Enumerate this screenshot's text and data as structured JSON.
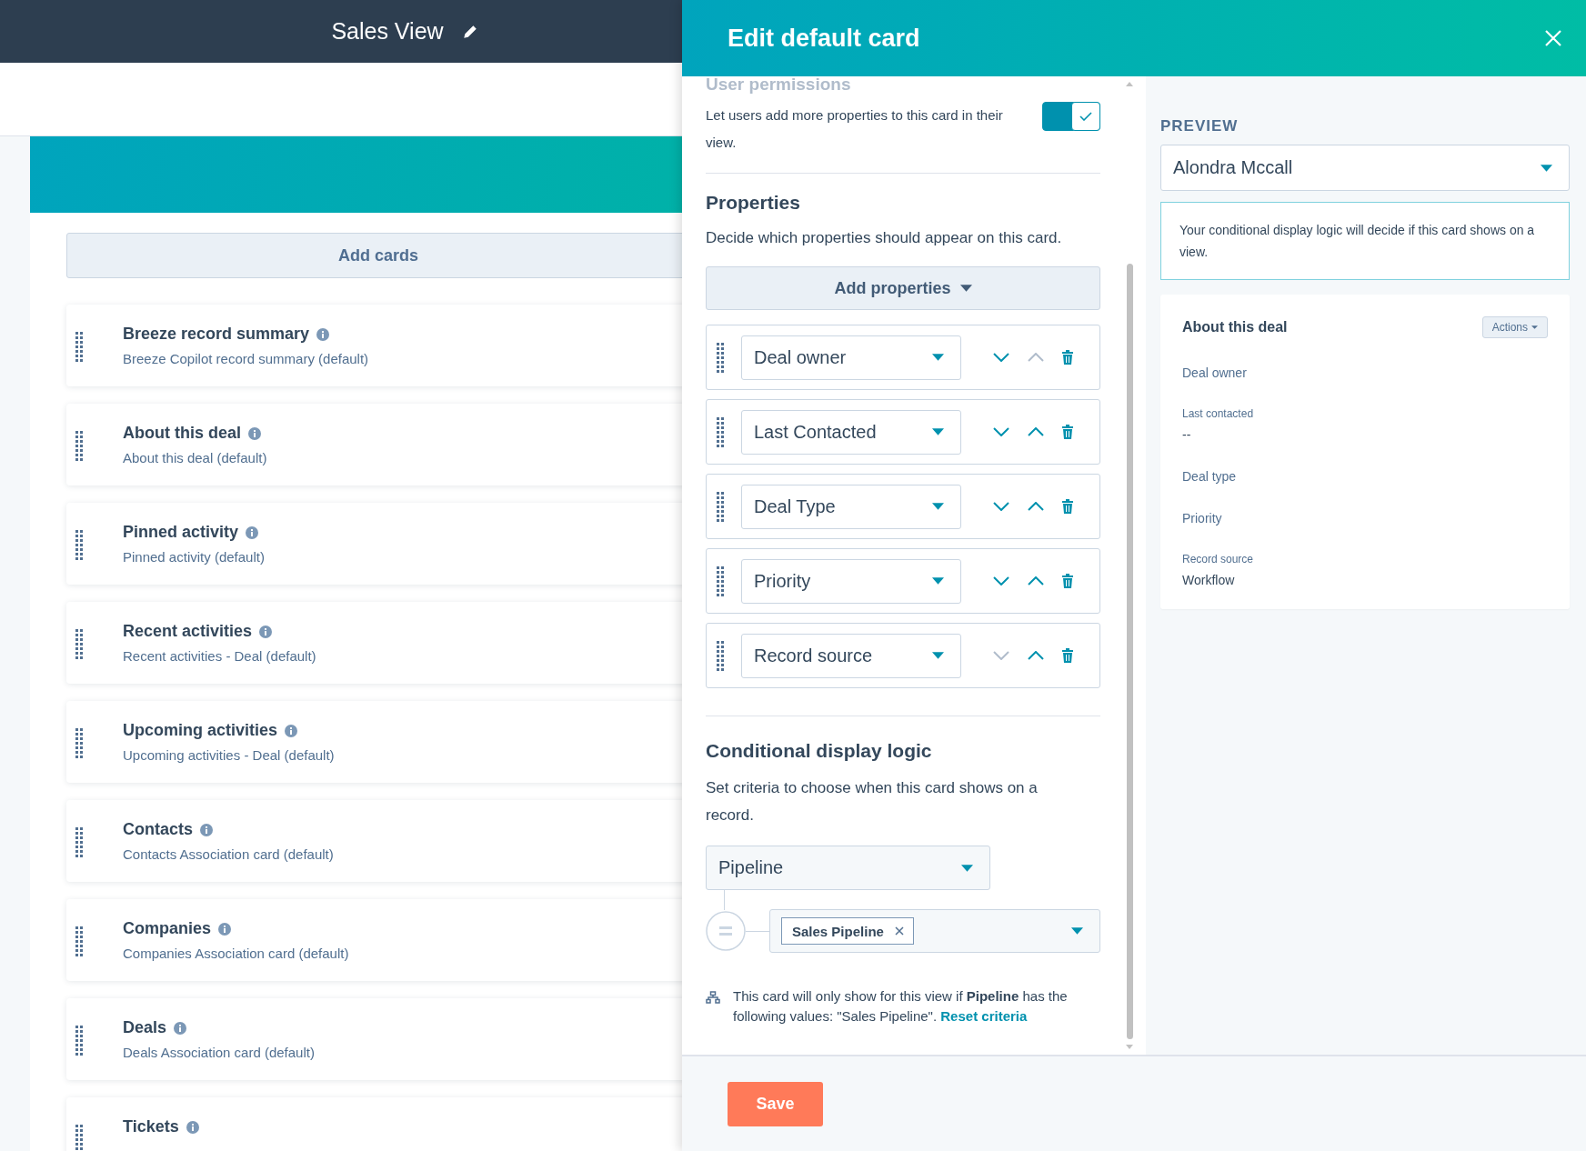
{
  "header": {
    "title": "Sales View"
  },
  "add_cards_button": "Add cards",
  "cards": [
    {
      "title": "Breeze record summary",
      "subtitle": "Breeze Copilot record summary (default)"
    },
    {
      "title": "About this deal",
      "subtitle": "About this deal (default)"
    },
    {
      "title": "Pinned activity",
      "subtitle": "Pinned activity (default)"
    },
    {
      "title": "Recent activities",
      "subtitle": "Recent activities - Deal (default)"
    },
    {
      "title": "Upcoming activities",
      "subtitle": "Upcoming activities - Deal (default)"
    },
    {
      "title": "Contacts",
      "subtitle": "Contacts Association card (default)"
    },
    {
      "title": "Companies",
      "subtitle": "Companies Association card (default)"
    },
    {
      "title": "Deals",
      "subtitle": "Deals Association card (default)"
    },
    {
      "title": "Tickets"
    }
  ],
  "panel": {
    "title": "Edit default card",
    "user_permissions": {
      "heading": "User permissions",
      "description": "Let users add more properties to this card in their view.",
      "on": true
    },
    "properties": {
      "heading": "Properties",
      "description": "Decide which properties should appear on this card.",
      "add_button": "Add properties",
      "items": [
        {
          "label": "Deal owner",
          "down_disabled": false,
          "up_disabled": true
        },
        {
          "label": "Last Contacted",
          "down_disabled": false,
          "up_disabled": false
        },
        {
          "label": "Deal Type",
          "down_disabled": false,
          "up_disabled": false
        },
        {
          "label": "Priority",
          "down_disabled": false,
          "up_disabled": false
        },
        {
          "label": "Record source",
          "down_disabled": true,
          "up_disabled": false
        }
      ]
    },
    "conditional": {
      "heading": "Conditional display logic",
      "description": "Set criteria to choose when this card shows on a record.",
      "property": "Pipeline",
      "values": [
        "Sales Pipeline"
      ],
      "summary": "This card will only show for this view if **Pipeline** has the following values: \"Sales Pipeline\".",
      "reset_link": "Reset criteria"
    },
    "save_button": "Save"
  },
  "preview": {
    "heading": "PREVIEW",
    "record": "Alondra Mccall",
    "notice": "Your conditional display logic will decide if this card shows on a view.",
    "card": {
      "title": "About this deal",
      "actions_button": "Actions",
      "fields": [
        {
          "label": "Deal owner"
        },
        {
          "label": "Last contacted",
          "value": "--"
        },
        {
          "label": "Deal type"
        },
        {
          "label": "Priority"
        },
        {
          "label": "Record source",
          "value": "Workflow"
        }
      ]
    }
  }
}
